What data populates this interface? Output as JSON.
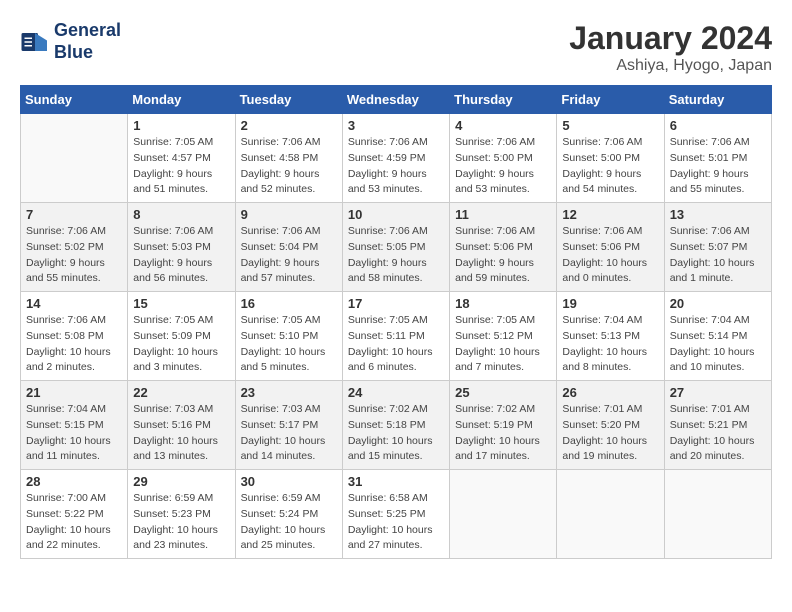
{
  "header": {
    "logo_line1": "General",
    "logo_line2": "Blue",
    "month_title": "January 2024",
    "location": "Ashiya, Hyogo, Japan"
  },
  "days_of_week": [
    "Sunday",
    "Monday",
    "Tuesday",
    "Wednesday",
    "Thursday",
    "Friday",
    "Saturday"
  ],
  "weeks": [
    [
      {
        "day": "",
        "sunrise": "",
        "sunset": "",
        "daylight": ""
      },
      {
        "day": "1",
        "sunrise": "7:05 AM",
        "sunset": "4:57 PM",
        "daylight": "9 hours and 51 minutes."
      },
      {
        "day": "2",
        "sunrise": "7:06 AM",
        "sunset": "4:58 PM",
        "daylight": "9 hours and 52 minutes."
      },
      {
        "day": "3",
        "sunrise": "7:06 AM",
        "sunset": "4:59 PM",
        "daylight": "9 hours and 53 minutes."
      },
      {
        "day": "4",
        "sunrise": "7:06 AM",
        "sunset": "5:00 PM",
        "daylight": "9 hours and 53 minutes."
      },
      {
        "day": "5",
        "sunrise": "7:06 AM",
        "sunset": "5:00 PM",
        "daylight": "9 hours and 54 minutes."
      },
      {
        "day": "6",
        "sunrise": "7:06 AM",
        "sunset": "5:01 PM",
        "daylight": "9 hours and 55 minutes."
      }
    ],
    [
      {
        "day": "7",
        "sunrise": "7:06 AM",
        "sunset": "5:02 PM",
        "daylight": "9 hours and 55 minutes."
      },
      {
        "day": "8",
        "sunrise": "7:06 AM",
        "sunset": "5:03 PM",
        "daylight": "9 hours and 56 minutes."
      },
      {
        "day": "9",
        "sunrise": "7:06 AM",
        "sunset": "5:04 PM",
        "daylight": "9 hours and 57 minutes."
      },
      {
        "day": "10",
        "sunrise": "7:06 AM",
        "sunset": "5:05 PM",
        "daylight": "9 hours and 58 minutes."
      },
      {
        "day": "11",
        "sunrise": "7:06 AM",
        "sunset": "5:06 PM",
        "daylight": "9 hours and 59 minutes."
      },
      {
        "day": "12",
        "sunrise": "7:06 AM",
        "sunset": "5:06 PM",
        "daylight": "10 hours and 0 minutes."
      },
      {
        "day": "13",
        "sunrise": "7:06 AM",
        "sunset": "5:07 PM",
        "daylight": "10 hours and 1 minute."
      }
    ],
    [
      {
        "day": "14",
        "sunrise": "7:06 AM",
        "sunset": "5:08 PM",
        "daylight": "10 hours and 2 minutes."
      },
      {
        "day": "15",
        "sunrise": "7:05 AM",
        "sunset": "5:09 PM",
        "daylight": "10 hours and 3 minutes."
      },
      {
        "day": "16",
        "sunrise": "7:05 AM",
        "sunset": "5:10 PM",
        "daylight": "10 hours and 5 minutes."
      },
      {
        "day": "17",
        "sunrise": "7:05 AM",
        "sunset": "5:11 PM",
        "daylight": "10 hours and 6 minutes."
      },
      {
        "day": "18",
        "sunrise": "7:05 AM",
        "sunset": "5:12 PM",
        "daylight": "10 hours and 7 minutes."
      },
      {
        "day": "19",
        "sunrise": "7:04 AM",
        "sunset": "5:13 PM",
        "daylight": "10 hours and 8 minutes."
      },
      {
        "day": "20",
        "sunrise": "7:04 AM",
        "sunset": "5:14 PM",
        "daylight": "10 hours and 10 minutes."
      }
    ],
    [
      {
        "day": "21",
        "sunrise": "7:04 AM",
        "sunset": "5:15 PM",
        "daylight": "10 hours and 11 minutes."
      },
      {
        "day": "22",
        "sunrise": "7:03 AM",
        "sunset": "5:16 PM",
        "daylight": "10 hours and 13 minutes."
      },
      {
        "day": "23",
        "sunrise": "7:03 AM",
        "sunset": "5:17 PM",
        "daylight": "10 hours and 14 minutes."
      },
      {
        "day": "24",
        "sunrise": "7:02 AM",
        "sunset": "5:18 PM",
        "daylight": "10 hours and 15 minutes."
      },
      {
        "day": "25",
        "sunrise": "7:02 AM",
        "sunset": "5:19 PM",
        "daylight": "10 hours and 17 minutes."
      },
      {
        "day": "26",
        "sunrise": "7:01 AM",
        "sunset": "5:20 PM",
        "daylight": "10 hours and 19 minutes."
      },
      {
        "day": "27",
        "sunrise": "7:01 AM",
        "sunset": "5:21 PM",
        "daylight": "10 hours and 20 minutes."
      }
    ],
    [
      {
        "day": "28",
        "sunrise": "7:00 AM",
        "sunset": "5:22 PM",
        "daylight": "10 hours and 22 minutes."
      },
      {
        "day": "29",
        "sunrise": "6:59 AM",
        "sunset": "5:23 PM",
        "daylight": "10 hours and 23 minutes."
      },
      {
        "day": "30",
        "sunrise": "6:59 AM",
        "sunset": "5:24 PM",
        "daylight": "10 hours and 25 minutes."
      },
      {
        "day": "31",
        "sunrise": "6:58 AM",
        "sunset": "5:25 PM",
        "daylight": "10 hours and 27 minutes."
      },
      {
        "day": "",
        "sunrise": "",
        "sunset": "",
        "daylight": ""
      },
      {
        "day": "",
        "sunrise": "",
        "sunset": "",
        "daylight": ""
      },
      {
        "day": "",
        "sunrise": "",
        "sunset": "",
        "daylight": ""
      }
    ]
  ]
}
